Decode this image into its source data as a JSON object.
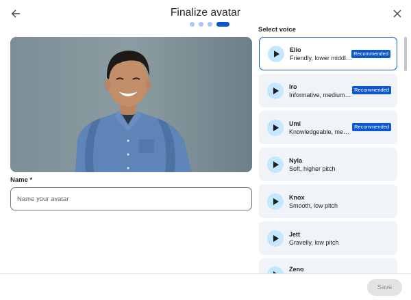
{
  "dialog": {
    "title": "Finalize avatar"
  },
  "stepper": {
    "total_steps": 4,
    "current_step": 4
  },
  "avatar": {
    "image": "portrait-smiling-man-blue-shirt"
  },
  "name_field": {
    "label": "Name *",
    "placeholder": "Name your avatar",
    "value": ""
  },
  "voices": {
    "label": "Select voice",
    "items": [
      {
        "name": "Elio",
        "desc": "Friendly, lower middle pitch",
        "badge": "Recommended",
        "selected": true
      },
      {
        "name": "Iro",
        "desc": "Informative, medium pitch",
        "badge": "Recommended"
      },
      {
        "name": "Umi",
        "desc": "Knowledgeable, medium pitch",
        "badge": "Recommended"
      },
      {
        "name": "Nyla",
        "desc": "Soft, higher pitch"
      },
      {
        "name": "Knox",
        "desc": "Smooth, low pitch"
      },
      {
        "name": "Jett",
        "desc": "Gravelly, low pitch"
      },
      {
        "name": "Zeno",
        "desc": ""
      }
    ]
  },
  "footer": {
    "save_label": "Save"
  },
  "colors": {
    "accent": "#0b57d0",
    "card_bg": "#f0f4f9",
    "play_bg": "#c2e7ff",
    "step_inactive": "#a8c7fa"
  },
  "icons": {
    "back": "arrow-back-icon",
    "close": "close-icon",
    "play": "play-icon"
  }
}
